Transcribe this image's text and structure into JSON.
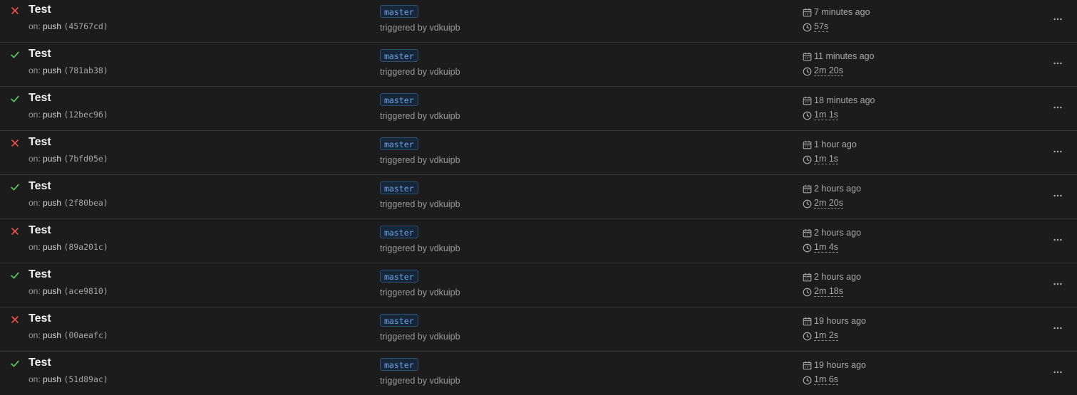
{
  "colors": {
    "success": "#57c25c",
    "failure": "#f0524b",
    "branch_text": "#6ea3e6",
    "background": "#1c1c1c"
  },
  "runs": [
    {
      "status": "failure",
      "status_icon": "x-icon",
      "title": "Test",
      "on_label": "on:",
      "event": "push",
      "sha": "(45767cd)",
      "branch": "master",
      "triggered": "triggered by vdkuipb",
      "when": "7 minutes ago",
      "duration": "57s"
    },
    {
      "status": "success",
      "status_icon": "check-icon",
      "title": "Test",
      "on_label": "on:",
      "event": "push",
      "sha": "(781ab38)",
      "branch": "master",
      "triggered": "triggered by vdkuipb",
      "when": "11 minutes ago",
      "duration": "2m 20s"
    },
    {
      "status": "success",
      "status_icon": "check-icon",
      "title": "Test",
      "on_label": "on:",
      "event": "push",
      "sha": "(12bec96)",
      "branch": "master",
      "triggered": "triggered by vdkuipb",
      "when": "18 minutes ago",
      "duration": "1m 1s"
    },
    {
      "status": "failure",
      "status_icon": "x-icon",
      "title": "Test",
      "on_label": "on:",
      "event": "push",
      "sha": "(7bfd05e)",
      "branch": "master",
      "triggered": "triggered by vdkuipb",
      "when": "1 hour ago",
      "duration": "1m 1s"
    },
    {
      "status": "success",
      "status_icon": "check-icon",
      "title": "Test",
      "on_label": "on:",
      "event": "push",
      "sha": "(2f80bea)",
      "branch": "master",
      "triggered": "triggered by vdkuipb",
      "when": "2 hours ago",
      "duration": "2m 20s"
    },
    {
      "status": "failure",
      "status_icon": "x-icon",
      "title": "Test",
      "on_label": "on:",
      "event": "push",
      "sha": "(89a201c)",
      "branch": "master",
      "triggered": "triggered by vdkuipb",
      "when": "2 hours ago",
      "duration": "1m 4s"
    },
    {
      "status": "success",
      "status_icon": "check-icon",
      "title": "Test",
      "on_label": "on:",
      "event": "push",
      "sha": "(ace9810)",
      "branch": "master",
      "triggered": "triggered by vdkuipb",
      "when": "2 hours ago",
      "duration": "2m 18s"
    },
    {
      "status": "failure",
      "status_icon": "x-icon",
      "title": "Test",
      "on_label": "on:",
      "event": "push",
      "sha": "(00aeafc)",
      "branch": "master",
      "triggered": "triggered by vdkuipb",
      "when": "19 hours ago",
      "duration": "1m 2s"
    },
    {
      "status": "success",
      "status_icon": "check-icon",
      "title": "Test",
      "on_label": "on:",
      "event": "push",
      "sha": "(51d89ac)",
      "branch": "master",
      "triggered": "triggered by vdkuipb",
      "when": "19 hours ago",
      "duration": "1m 6s"
    }
  ]
}
